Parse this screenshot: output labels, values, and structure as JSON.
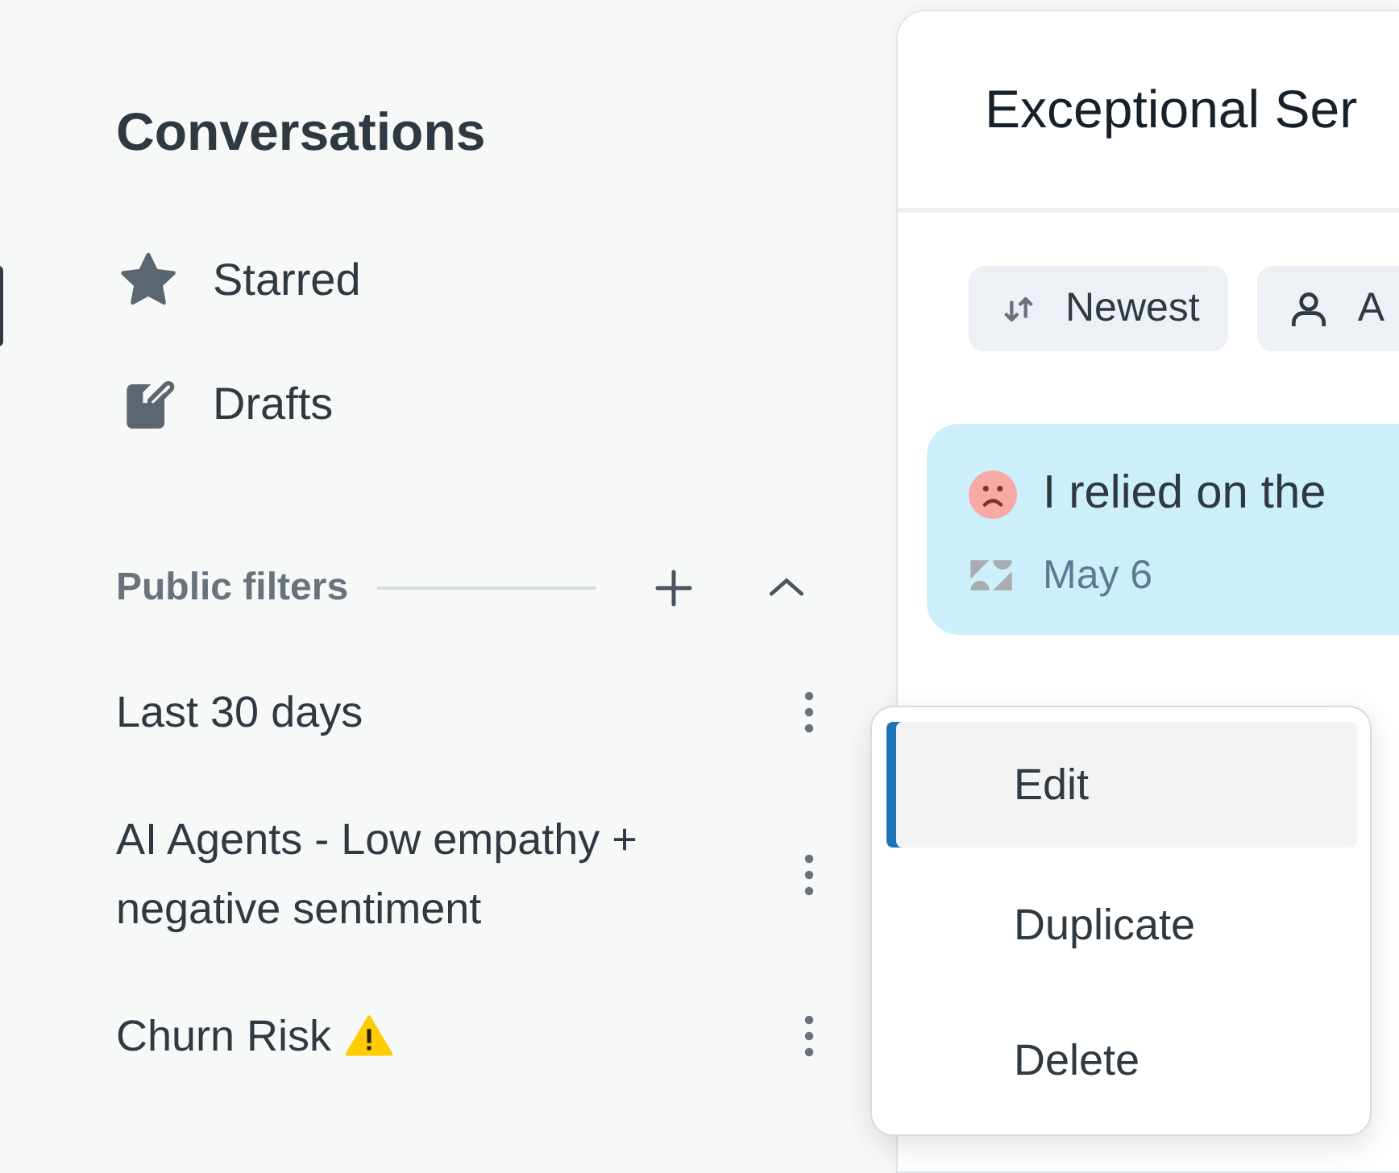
{
  "sidebar": {
    "title": "Conversations",
    "items": [
      {
        "kind": "star",
        "label": "Starred"
      },
      {
        "kind": "draft",
        "label": "Drafts"
      }
    ],
    "public_filters": {
      "title": "Public filters",
      "expanded": true,
      "filters": [
        {
          "kind": "plain",
          "label": "Last 30 days"
        },
        {
          "kind": "plain",
          "label": "AI Agents - Low empathy + negative sentiment"
        },
        {
          "kind": "warning",
          "label": "Churn Risk"
        }
      ]
    }
  },
  "panel": {
    "title": "Exceptional Ser",
    "chips": [
      {
        "kind": "sort",
        "label": "Newest"
      },
      {
        "kind": "person",
        "label": "A"
      }
    ],
    "conversations": [
      {
        "kind": "negative",
        "text": "I relied on the",
        "date": "May 6",
        "selected": true
      }
    ]
  },
  "menu": {
    "items": [
      {
        "label": "Edit",
        "selected": true
      },
      {
        "label": "Duplicate",
        "selected": false
      },
      {
        "label": "Delete",
        "selected": false
      }
    ]
  }
}
